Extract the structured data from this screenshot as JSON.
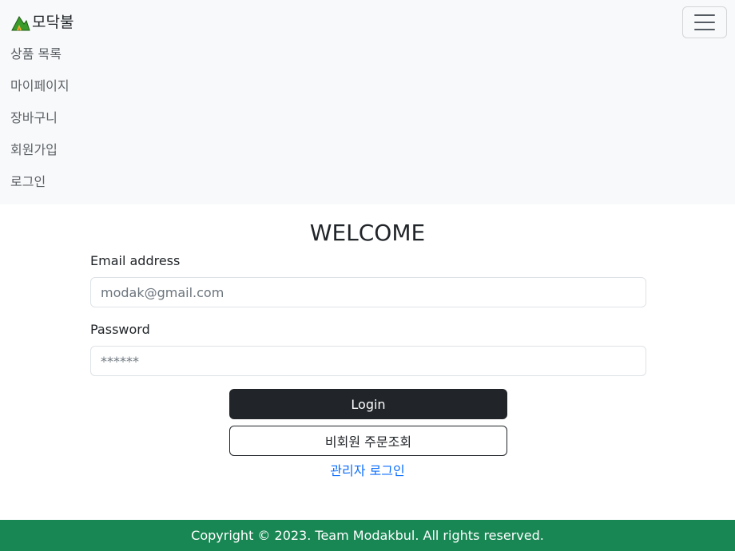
{
  "navbar": {
    "brand_name": "모닥불",
    "items": [
      {
        "label": "상품 목록"
      },
      {
        "label": "마이페이지"
      },
      {
        "label": "장바구니"
      },
      {
        "label": "회원가입"
      },
      {
        "label": "로그인"
      }
    ],
    "icons": {
      "brand": "mountain-fire-logo",
      "toggler": "hamburger-menu-icon"
    }
  },
  "main": {
    "title": "WELCOME",
    "email": {
      "label": "Email address",
      "placeholder": "modak@gmail.com",
      "value": ""
    },
    "password": {
      "label": "Password",
      "placeholder": "******",
      "value": ""
    },
    "login_button": "Login",
    "guest_order_button": "비회원 주문조회",
    "admin_login_link": "관리자 로그인"
  },
  "footer": {
    "text": "Copyright © 2023. Team Modakbul. All rights reserved."
  },
  "colors": {
    "navbar_bg": "#f8f9fa",
    "dark_button": "#212529",
    "link": "#0d6efd",
    "footer_bg": "#198754"
  }
}
